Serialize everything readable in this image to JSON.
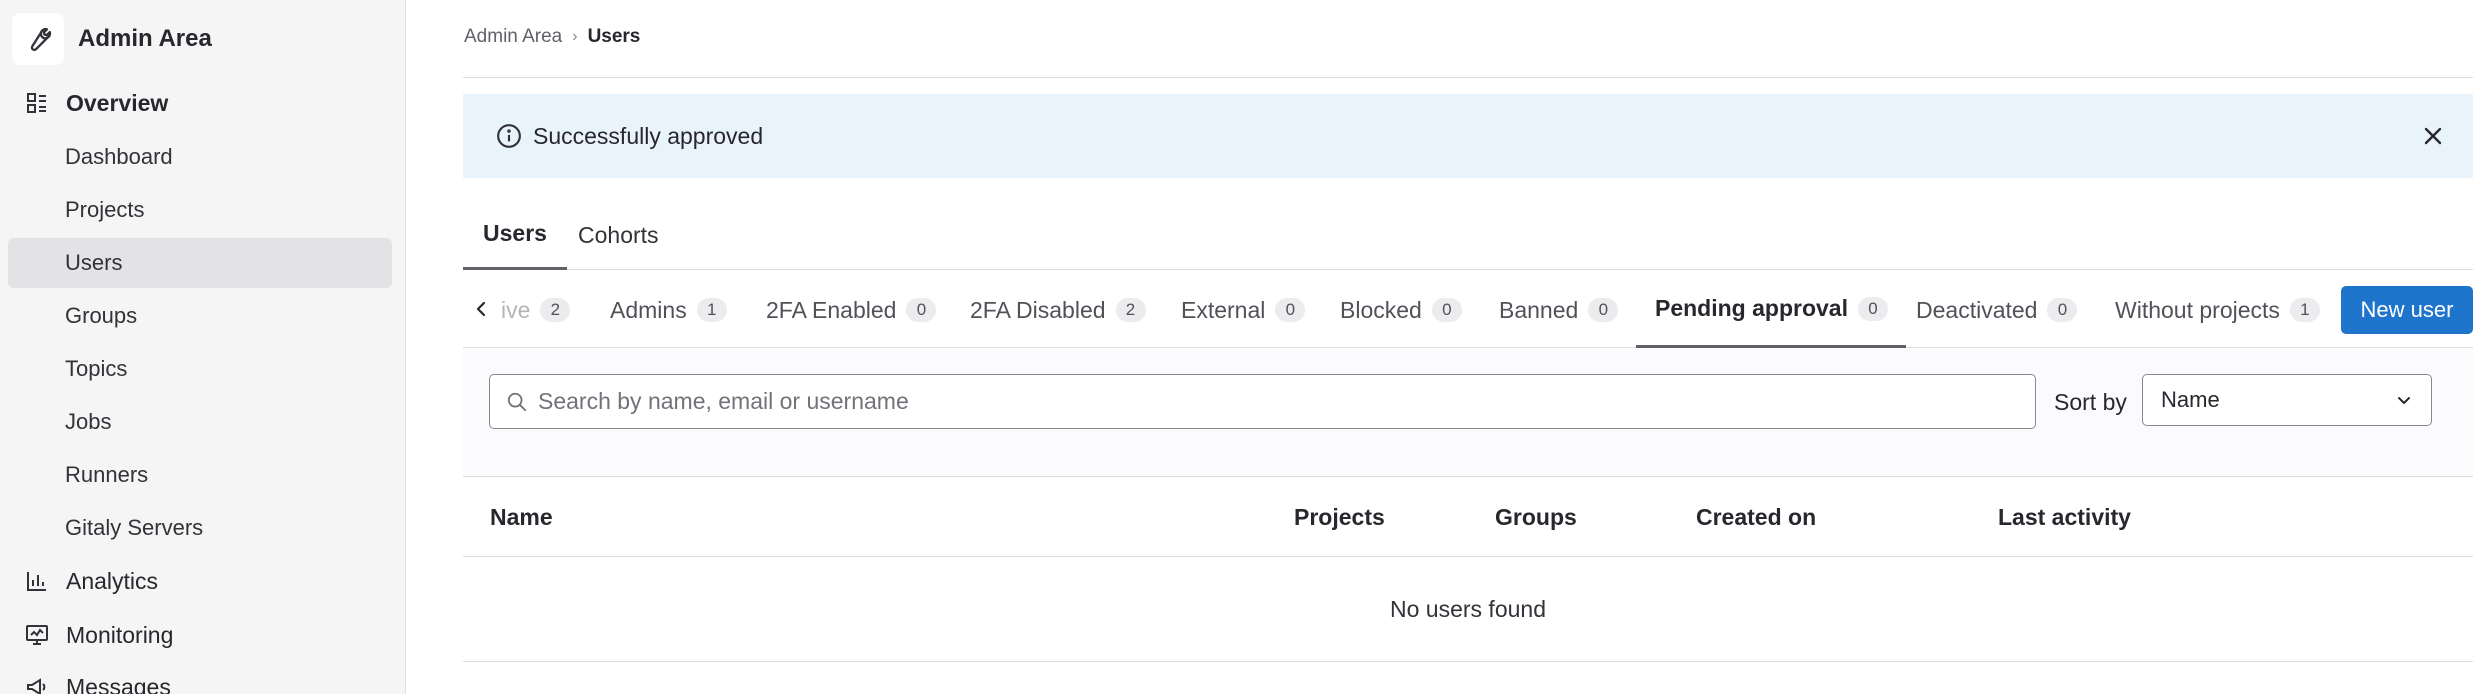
{
  "sidebar": {
    "brand": "Admin Area",
    "overview_label": "Overview",
    "items": [
      {
        "label": "Dashboard"
      },
      {
        "label": "Projects"
      },
      {
        "label": "Users"
      },
      {
        "label": "Groups"
      },
      {
        "label": "Topics"
      },
      {
        "label": "Jobs"
      },
      {
        "label": "Runners"
      },
      {
        "label": "Gitaly Servers"
      }
    ],
    "sections": [
      {
        "label": "Analytics",
        "icon": "chart-icon"
      },
      {
        "label": "Monitoring",
        "icon": "monitor-icon"
      },
      {
        "label": "Messages",
        "icon": "megaphone-icon"
      }
    ]
  },
  "breadcrumb": {
    "root": "Admin Area",
    "current": "Users"
  },
  "alert": {
    "message": "Successfully approved"
  },
  "tabs": [
    {
      "label": "Users"
    },
    {
      "label": "Cohorts"
    }
  ],
  "filters": [
    {
      "label": "ive",
      "count": "2"
    },
    {
      "label": "Admins",
      "count": "1"
    },
    {
      "label": "2FA Enabled",
      "count": "0"
    },
    {
      "label": "2FA Disabled",
      "count": "2"
    },
    {
      "label": "External",
      "count": "0"
    },
    {
      "label": "Blocked",
      "count": "0"
    },
    {
      "label": "Banned",
      "count": "0"
    },
    {
      "label": "Pending approval",
      "count": "0"
    },
    {
      "label": "Deactivated",
      "count": "0"
    },
    {
      "label": "Without projects",
      "count": "1"
    }
  ],
  "new_user_label": "New user",
  "search": {
    "placeholder": "Search by name, email or username",
    "value": ""
  },
  "sort": {
    "label": "Sort by",
    "selected": "Name"
  },
  "table": {
    "headers": [
      "Name",
      "Projects",
      "Groups",
      "Created on",
      "Last activity"
    ],
    "empty_message": "No users found"
  },
  "colors": {
    "primary": "#1f75cb",
    "alert_bg": "#e9f3fc",
    "sidebar_bg": "#f5f5f5",
    "active_item_bg": "#e3e3e6"
  }
}
